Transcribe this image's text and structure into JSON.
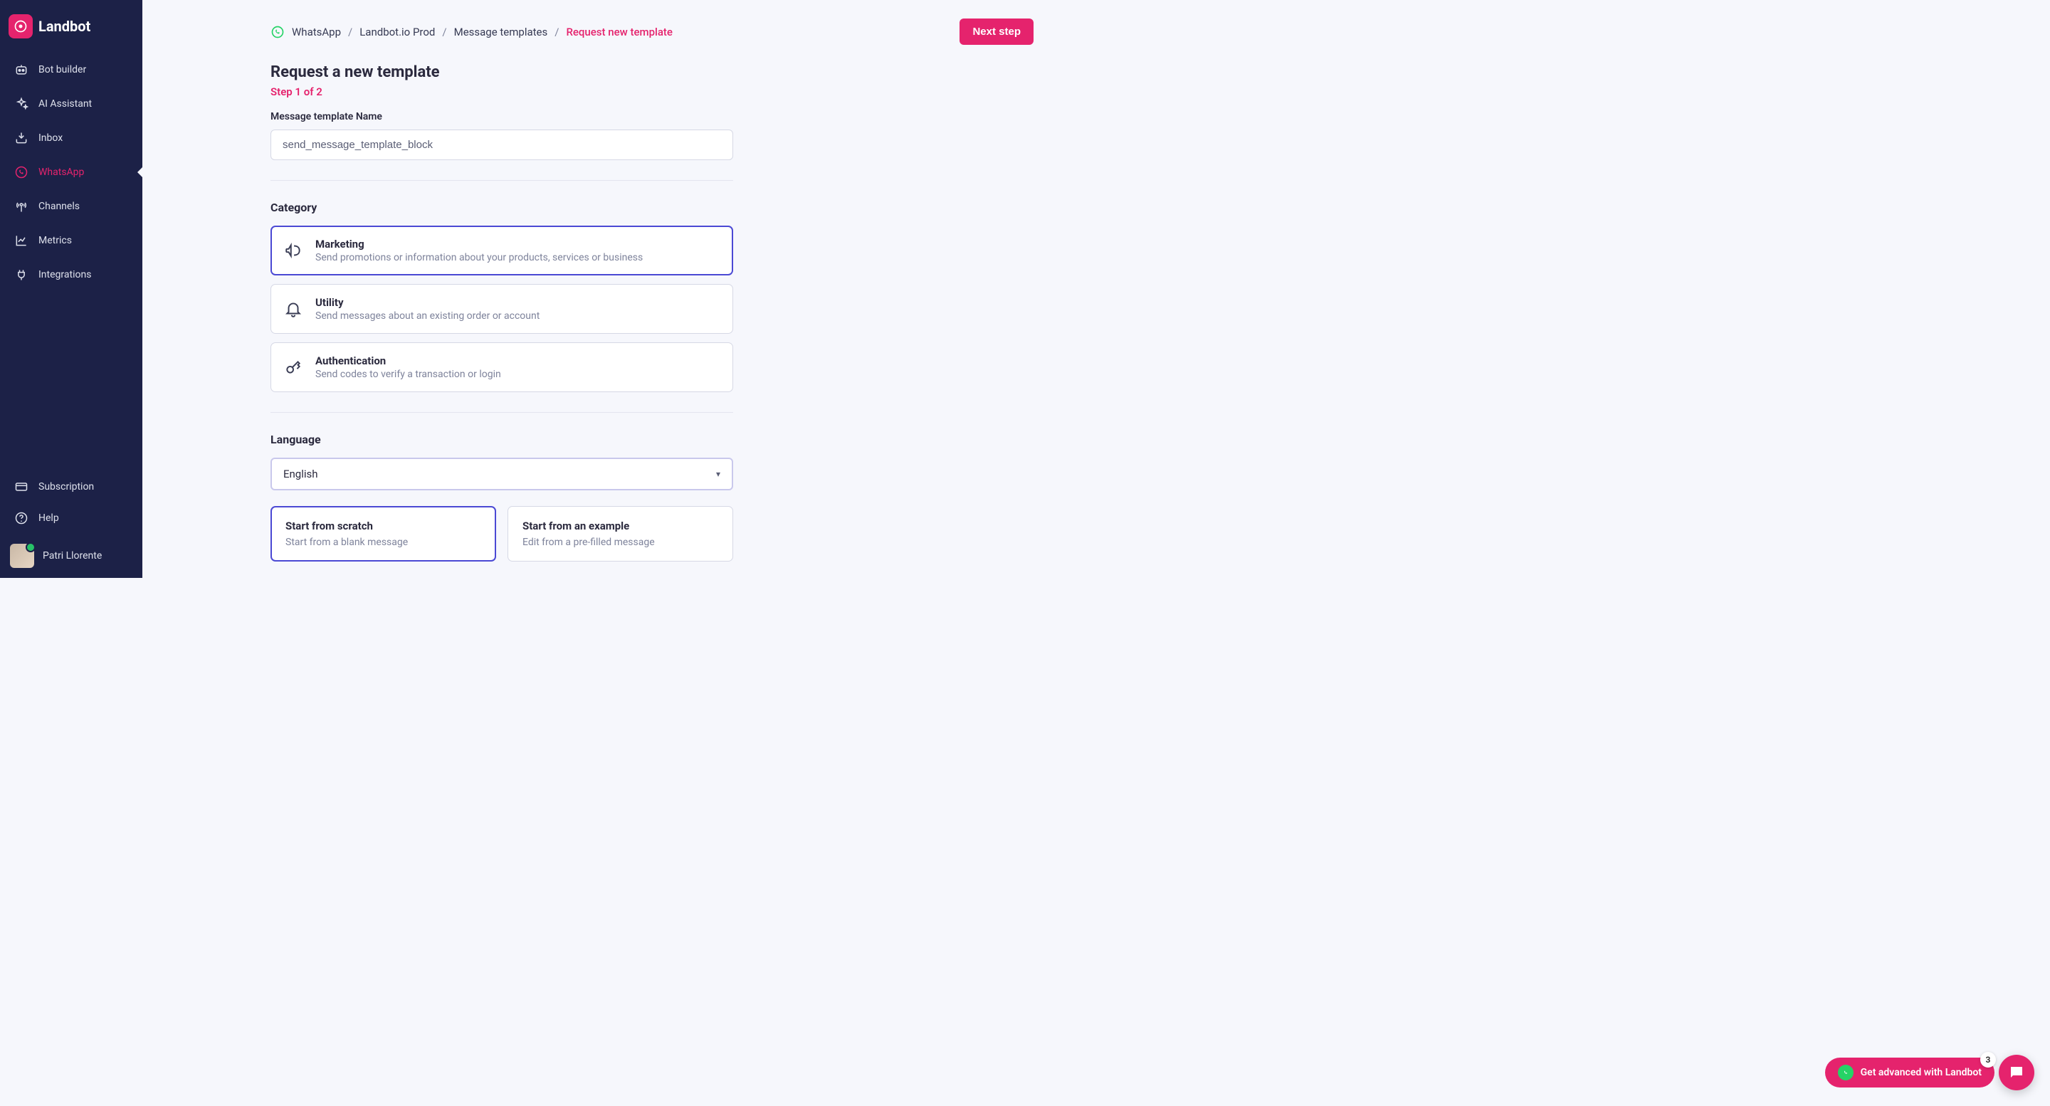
{
  "brand": {
    "name": "Landbot"
  },
  "sidebar": {
    "items": [
      {
        "label": "Bot builder",
        "icon": "bot"
      },
      {
        "label": "AI Assistant",
        "icon": "sparkle"
      },
      {
        "label": "Inbox",
        "icon": "inbox"
      },
      {
        "label": "WhatsApp",
        "icon": "whatsapp",
        "active": true
      },
      {
        "label": "Channels",
        "icon": "antenna"
      },
      {
        "label": "Metrics",
        "icon": "chart"
      },
      {
        "label": "Integrations",
        "icon": "plug"
      }
    ],
    "bottom": [
      {
        "label": "Subscription",
        "icon": "card"
      },
      {
        "label": "Help",
        "icon": "help"
      }
    ],
    "user": {
      "name": "Patri Llorente"
    }
  },
  "header": {
    "crumbs": [
      "WhatsApp",
      "Landbot.io Prod",
      "Message templates",
      "Request new template"
    ],
    "next_label": "Next step"
  },
  "page": {
    "title": "Request a new template",
    "step": "Step 1 of 2",
    "name_label": "Message template Name",
    "name_value": "send_message_template_block",
    "category_label": "Category",
    "categories": [
      {
        "title": "Marketing",
        "desc": "Send promotions or information about your products, services or business",
        "icon": "megaphone",
        "selected": true
      },
      {
        "title": "Utility",
        "desc": "Send messages about an existing order or account",
        "icon": "bell",
        "selected": false
      },
      {
        "title": "Authentication",
        "desc": "Send codes to verify a transaction or login",
        "icon": "key",
        "selected": false
      }
    ],
    "language_label": "Language",
    "language_value": "English",
    "start_options": [
      {
        "title": "Start from scratch",
        "desc": "Start from a blank message",
        "selected": true
      },
      {
        "title": "Start from an example",
        "desc": "Edit from a pre-filled message",
        "selected": false
      }
    ]
  },
  "float": {
    "pill_label": "Get advanced with Landbot",
    "badge": "3"
  }
}
